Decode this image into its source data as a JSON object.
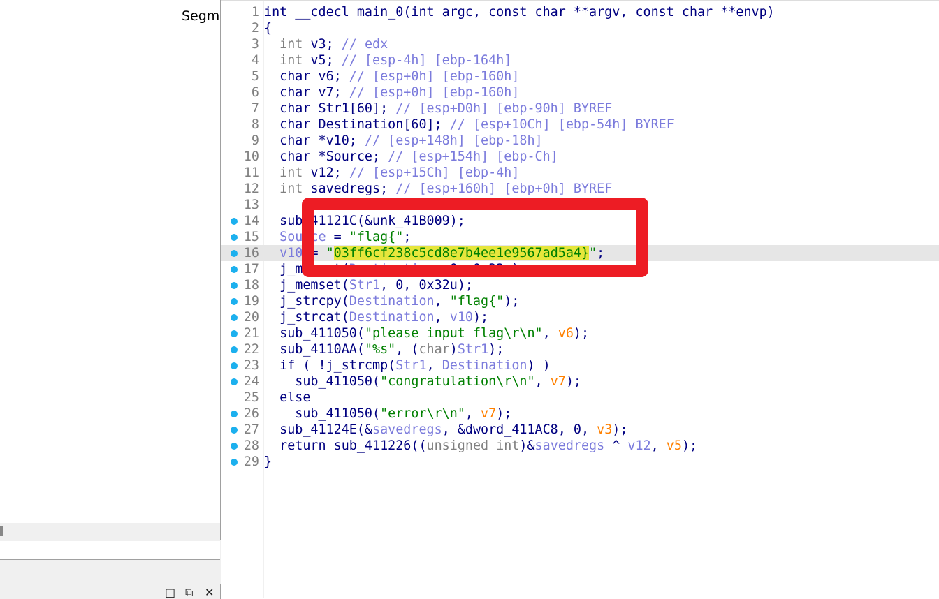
{
  "left_panel": {
    "column_header": "Segme",
    "window_buttons": [
      "maximize-icon",
      "restore-icon",
      "close-icon"
    ]
  },
  "colors": {
    "annotation_box": "#ed1c24",
    "highlight": "#e6e63c",
    "breakpoint_dot": "#1cb0ee"
  },
  "current_line": 16,
  "lines": [
    {
      "num": "1",
      "dot": false,
      "tokens": [
        [
          "int __cdecl main_0(int argc, const char **argv, const char **envp)",
          "k"
        ]
      ]
    },
    {
      "num": "2",
      "dot": false,
      "tokens": [
        [
          "{",
          "k"
        ]
      ]
    },
    {
      "num": "3",
      "dot": false,
      "tokens": [
        [
          "  int",
          "t"
        ],
        [
          " v3; ",
          "k"
        ],
        [
          "// edx",
          "c"
        ]
      ]
    },
    {
      "num": "4",
      "dot": false,
      "tokens": [
        [
          "  int",
          "t"
        ],
        [
          " v5; ",
          "k"
        ],
        [
          "// [esp-4h] [ebp-164h]",
          "c"
        ]
      ]
    },
    {
      "num": "5",
      "dot": false,
      "tokens": [
        [
          "  char v6; ",
          "k"
        ],
        [
          "// [esp+0h] [ebp-160h]",
          "c"
        ]
      ]
    },
    {
      "num": "6",
      "dot": false,
      "tokens": [
        [
          "  char v7; ",
          "k"
        ],
        [
          "// [esp+0h] [ebp-160h]",
          "c"
        ]
      ]
    },
    {
      "num": "7",
      "dot": false,
      "tokens": [
        [
          "  char Str1[60]; ",
          "k"
        ],
        [
          "// [esp+D0h] [ebp-90h] BYREF",
          "c"
        ]
      ]
    },
    {
      "num": "8",
      "dot": false,
      "tokens": [
        [
          "  char Destination[60]; ",
          "k"
        ],
        [
          "// [esp+10Ch] [ebp-54h] BYREF",
          "c"
        ]
      ]
    },
    {
      "num": "9",
      "dot": false,
      "tokens": [
        [
          "  char *v10; ",
          "k"
        ],
        [
          "// [esp+148h] [ebp-18h]",
          "c"
        ]
      ]
    },
    {
      "num": "10",
      "dot": false,
      "tokens": [
        [
          "  char *Source; ",
          "k"
        ],
        [
          "// [esp+154h] [ebp-Ch]",
          "c"
        ]
      ]
    },
    {
      "num": "11",
      "dot": false,
      "tokens": [
        [
          "  int",
          "t"
        ],
        [
          " v12; ",
          "k"
        ],
        [
          "// [esp+15Ch] [ebp-4h]",
          "c"
        ]
      ]
    },
    {
      "num": "12",
      "dot": false,
      "tokens": [
        [
          "  int",
          "t"
        ],
        [
          " savedregs; ",
          "k"
        ],
        [
          "// [esp+160h] [ebp+0h] BYREF",
          "c"
        ]
      ]
    },
    {
      "num": "13",
      "dot": false,
      "tokens": []
    },
    {
      "num": "14",
      "dot": true,
      "tokens": [
        [
          "  sub_41121C(&unk_41B009);",
          "k"
        ]
      ]
    },
    {
      "num": "15",
      "dot": true,
      "tokens": [
        [
          "  Source",
          "v"
        ],
        [
          " = ",
          "k"
        ],
        [
          "\"flag{\"",
          "s"
        ],
        [
          ";",
          "k"
        ]
      ]
    },
    {
      "num": "16",
      "dot": true,
      "tokens": [
        [
          "  v10",
          "v"
        ],
        [
          " = ",
          "k"
        ],
        [
          "\"",
          "s"
        ],
        [
          "03ff6cf238c5cd8e7b4ee1e9567ad5a4}",
          "hl"
        ],
        [
          "\"",
          "s"
        ],
        [
          ";",
          "k"
        ]
      ]
    },
    {
      "num": "17",
      "dot": true,
      "tokens": [
        [
          "  j_memset(",
          "k"
        ],
        [
          "Destination",
          "v"
        ],
        [
          ", 0, 0x32u);",
          "k"
        ]
      ]
    },
    {
      "num": "18",
      "dot": true,
      "tokens": [
        [
          "  j_memset(",
          "k"
        ],
        [
          "Str1",
          "v"
        ],
        [
          ", 0, 0x32u);",
          "k"
        ]
      ]
    },
    {
      "num": "19",
      "dot": true,
      "tokens": [
        [
          "  j_strcpy(",
          "k"
        ],
        [
          "Destination",
          "v"
        ],
        [
          ", ",
          "k"
        ],
        [
          "\"flag{\"",
          "s"
        ],
        [
          ");",
          "k"
        ]
      ]
    },
    {
      "num": "20",
      "dot": true,
      "tokens": [
        [
          "  j_strcat(",
          "k"
        ],
        [
          "Destination",
          "v"
        ],
        [
          ", ",
          "k"
        ],
        [
          "v10",
          "v"
        ],
        [
          ");",
          "k"
        ]
      ]
    },
    {
      "num": "21",
      "dot": true,
      "tokens": [
        [
          "  sub_411050(",
          "k"
        ],
        [
          "\"please input flag\\r\\n\"",
          "s"
        ],
        [
          ", ",
          "k"
        ],
        [
          "v6",
          "o"
        ],
        [
          ");",
          "k"
        ]
      ]
    },
    {
      "num": "22",
      "dot": true,
      "tokens": [
        [
          "  sub_4110AA(",
          "k"
        ],
        [
          "\"%s\"",
          "s"
        ],
        [
          ", (",
          "k"
        ],
        [
          "char",
          "t"
        ],
        [
          ")",
          "k"
        ],
        [
          "Str1",
          "v"
        ],
        [
          ");",
          "k"
        ]
      ]
    },
    {
      "num": "23",
      "dot": true,
      "tokens": [
        [
          "  if ( !j_strcmp(",
          "k"
        ],
        [
          "Str1",
          "v"
        ],
        [
          ", ",
          "k"
        ],
        [
          "Destination",
          "v"
        ],
        [
          ") )",
          "k"
        ]
      ]
    },
    {
      "num": "24",
      "dot": true,
      "tokens": [
        [
          "    sub_411050(",
          "k"
        ],
        [
          "\"congratulation\\r\\n\"",
          "s"
        ],
        [
          ", ",
          "k"
        ],
        [
          "v7",
          "o"
        ],
        [
          ");",
          "k"
        ]
      ]
    },
    {
      "num": "25",
      "dot": false,
      "tokens": [
        [
          "  else",
          "k"
        ]
      ]
    },
    {
      "num": "26",
      "dot": true,
      "tokens": [
        [
          "    sub_411050(",
          "k"
        ],
        [
          "\"error\\r\\n\"",
          "s"
        ],
        [
          ", ",
          "k"
        ],
        [
          "v7",
          "o"
        ],
        [
          ");",
          "k"
        ]
      ]
    },
    {
      "num": "27",
      "dot": true,
      "tokens": [
        [
          "  sub_41124E(&",
          "k"
        ],
        [
          "savedregs",
          "v"
        ],
        [
          ", &dword_411AC8, 0, ",
          "k"
        ],
        [
          "v3",
          "o"
        ],
        [
          ");",
          "k"
        ]
      ]
    },
    {
      "num": "28",
      "dot": true,
      "tokens": [
        [
          "  return sub_411226((",
          "k"
        ],
        [
          "unsigned int",
          "t"
        ],
        [
          ")&",
          "k"
        ],
        [
          "savedregs",
          "v"
        ],
        [
          " ^ ",
          "k"
        ],
        [
          "v12",
          "v"
        ],
        [
          ", ",
          "k"
        ],
        [
          "v5",
          "o"
        ],
        [
          ");",
          "k"
        ]
      ]
    },
    {
      "num": "29",
      "dot": true,
      "tokens": [
        [
          "}",
          "k"
        ]
      ]
    }
  ]
}
